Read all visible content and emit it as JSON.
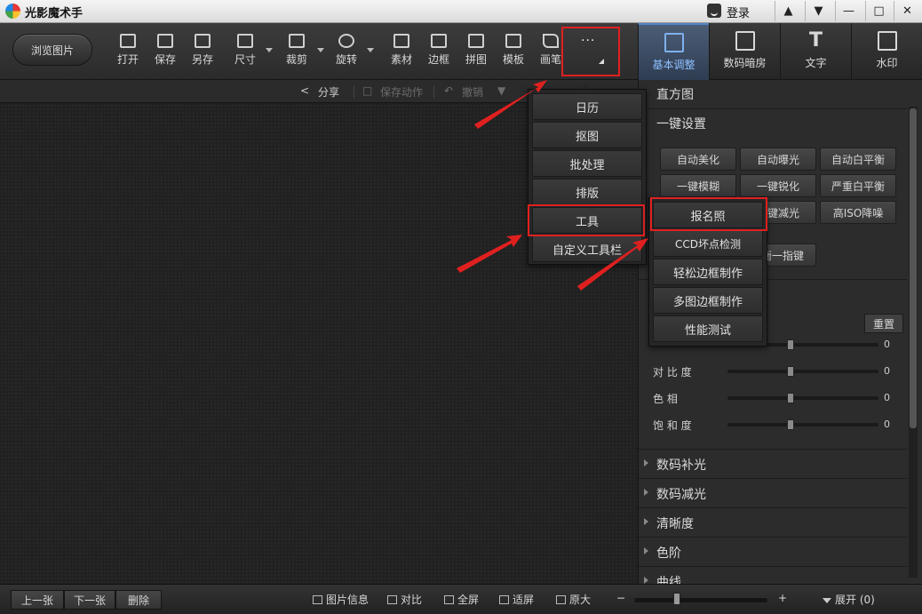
{
  "window": {
    "title": "光影魔术手",
    "login_label": "登录",
    "controls": [
      "skin",
      "menu",
      "minimize",
      "maximize",
      "close"
    ]
  },
  "toolbar": {
    "browse_label": "浏览图片",
    "tools": [
      {
        "label": "打开",
        "icon": "open-icon"
      },
      {
        "label": "保存",
        "icon": "save-icon"
      },
      {
        "label": "另存",
        "icon": "save-as-icon"
      },
      {
        "label": "尺寸",
        "icon": "resize-icon"
      },
      {
        "label": "裁剪",
        "icon": "crop-icon"
      },
      {
        "label": "旋转",
        "icon": "rotate-icon"
      },
      {
        "label": "素材",
        "icon": "material-icon"
      },
      {
        "label": "边框",
        "icon": "border-icon"
      },
      {
        "label": "拼图",
        "icon": "collage-icon"
      },
      {
        "label": "模板",
        "icon": "template-icon"
      },
      {
        "label": "画笔",
        "icon": "brush-icon"
      }
    ],
    "more_dots": "···"
  },
  "right_tabs": [
    {
      "label": "基本调整",
      "icon": "adjust-icon",
      "active": true
    },
    {
      "label": "数码暗房",
      "icon": "darkroom-icon",
      "active": false
    },
    {
      "label": "文字",
      "icon": "text-icon",
      "active": false
    },
    {
      "label": "水印",
      "icon": "watermark-icon",
      "active": false
    }
  ],
  "subbar": {
    "share": "分享",
    "save_action": "保存动作",
    "undo": "撤销"
  },
  "more_menu": {
    "items": [
      "日历",
      "抠图",
      "批处理",
      "排版",
      "工具",
      "自定义工具栏"
    ],
    "highlighted": "工具"
  },
  "tools_submenu": {
    "items": [
      "报名照",
      "CCD坏点检测",
      "轻松边框制作",
      "多图边框制作",
      "性能测试"
    ],
    "highlighted": "报名照"
  },
  "right_panel": {
    "histogram_title": "直方图",
    "onekey_title": "一键设置",
    "onekey_buttons": [
      [
        "自动美化",
        "自动曝光",
        "自动白平衡"
      ],
      [
        "一键模糊",
        "一键锐化",
        "严重白平衡"
      ],
      [
        "",
        "一键减光",
        "高ISO降噪"
      ]
    ],
    "partial_button": "衡一指键",
    "reset_label": "重置",
    "sliders": [
      {
        "label": "",
        "value": 0
      },
      {
        "label": "对 比 度",
        "value": 0
      },
      {
        "label": "色    相",
        "value": 0
      },
      {
        "label": "饱 和 度",
        "value": 0
      }
    ],
    "collapsed_sections": [
      "数码补光",
      "数码减光",
      "清晰度",
      "色阶",
      "曲线"
    ]
  },
  "bottombar": {
    "prev": "上一张",
    "next": "下一张",
    "delete": "删除",
    "info": "图片信息",
    "compare": "对比",
    "fullscreen": "全屏",
    "fit": "适屏",
    "original": "原大",
    "minus": "−",
    "plus": "+",
    "expand": "展开 (0)",
    "zoom_fraction": 0.3
  },
  "accent_colors": {
    "highlight": "#e02020",
    "active_tab": "#4f86c6"
  }
}
